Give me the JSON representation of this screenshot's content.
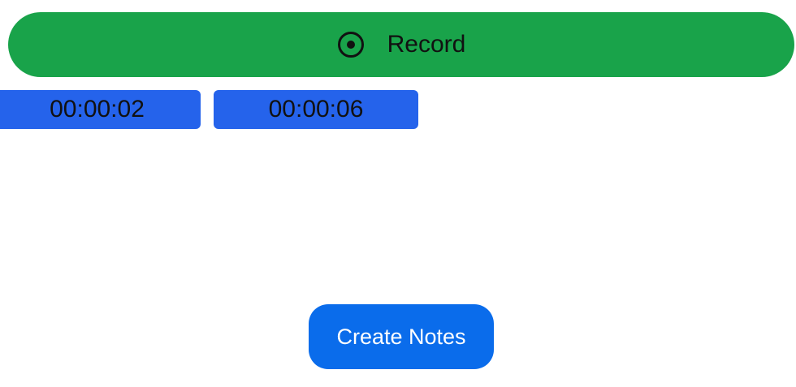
{
  "record_button": {
    "label": "Record",
    "icon": "record-icon",
    "color": "#19a34a"
  },
  "clips": [
    {
      "time": "00:00:02"
    },
    {
      "time": "00:00:06"
    }
  ],
  "clip_color": "#2563eb",
  "create_notes": {
    "label": "Create Notes",
    "color": "#0a6ceb"
  }
}
